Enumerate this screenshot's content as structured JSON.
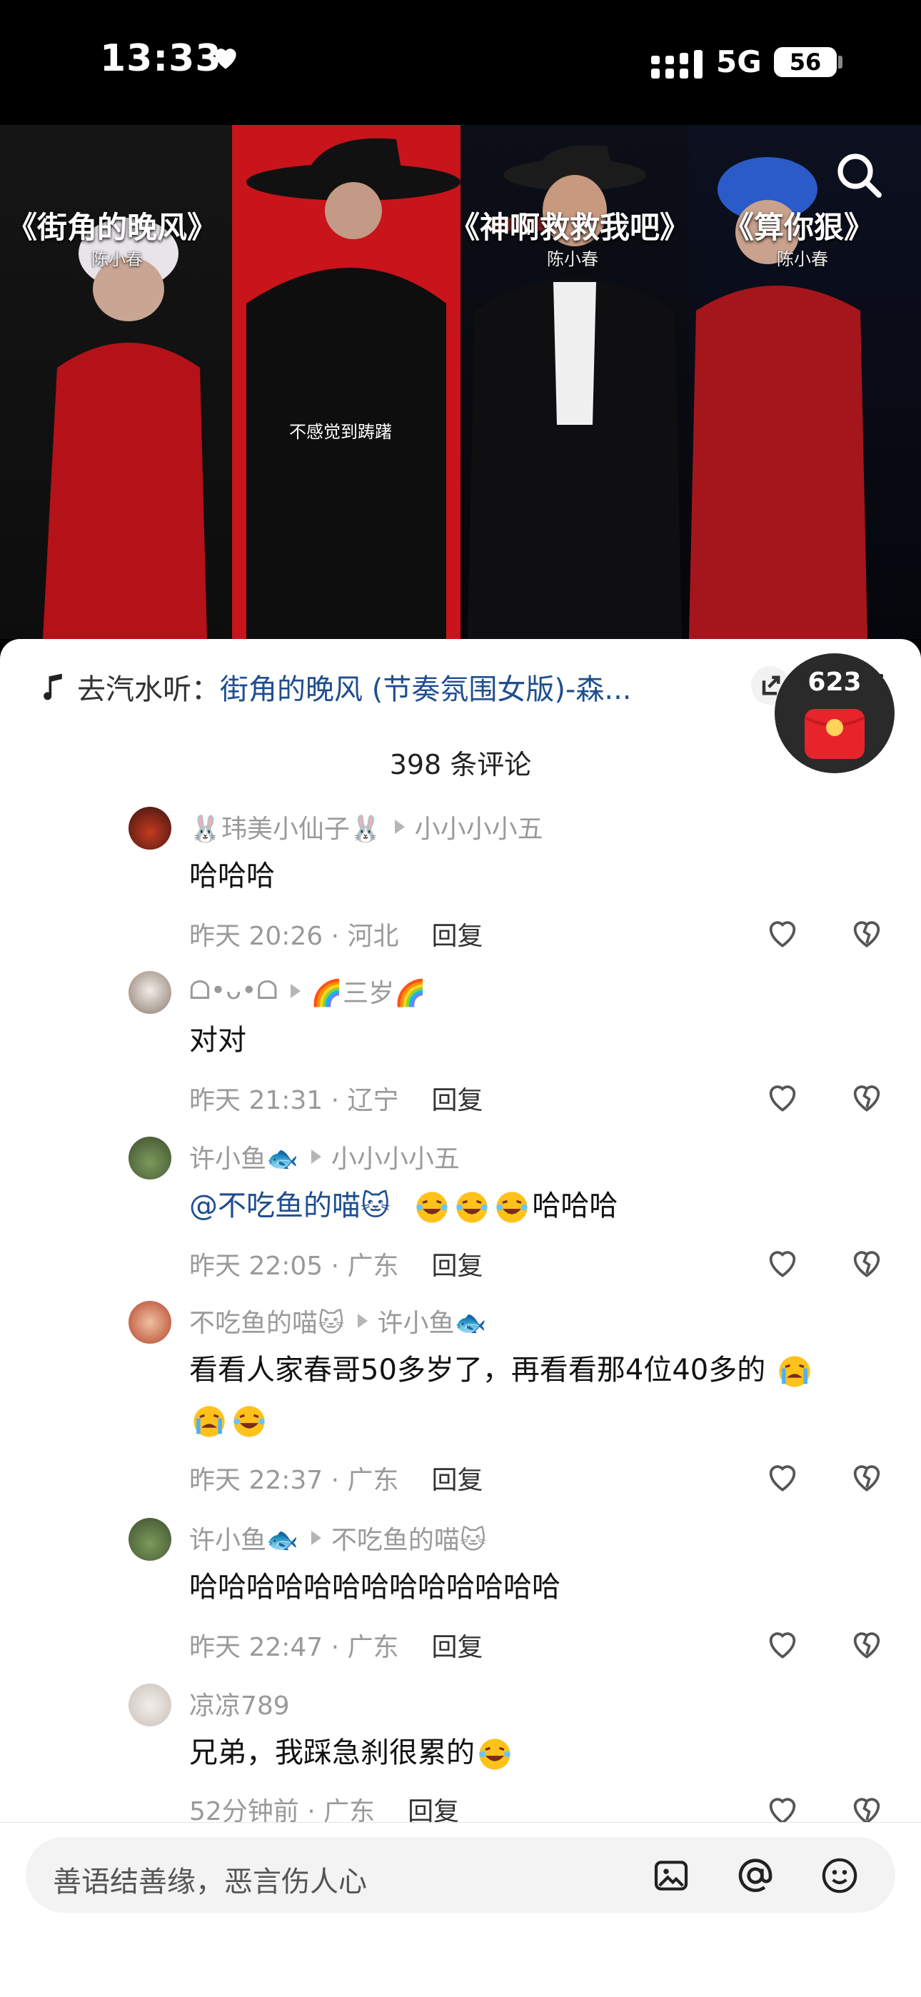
{
  "status_bar": {
    "time": "13:33",
    "network": "5G",
    "battery": "56"
  },
  "video": {
    "songs": [
      {
        "title": "《街角的晚风》",
        "artist": "陈小春"
      },
      {
        "title": "《神啊救救我吧》",
        "artist": "陈小春"
      },
      {
        "title": "《算你狠》",
        "artist": "陈小春"
      }
    ],
    "subtitle": "不感觉到踌躇"
  },
  "music_bar": {
    "prefix": "去汽水听：",
    "title": "街角的晚风 (节奏氛围女版)-森..."
  },
  "red_packet": {
    "count": "623"
  },
  "comments_header": {
    "count_label": "398 条评论"
  },
  "comments": [
    {
      "user": "🐰玮美小仙子🐰",
      "reply_to": "小小小小五",
      "text": "哈哈哈",
      "time": "昨天 20:26 · 河北",
      "reply": "回复"
    },
    {
      "user": "ᗝ•ᴗ•ᗝ",
      "reply_to": "🌈三岁🌈",
      "text": "对对",
      "time": "昨天 21:31 · 辽宁",
      "reply": "回复"
    },
    {
      "user": "许小鱼🐟",
      "reply_to": "小小小小五",
      "mention": "@不吃鱼的喵🐱",
      "text": "哈哈哈",
      "time": "昨天 22:05 · 广东",
      "reply": "回复"
    },
    {
      "user": "不吃鱼的喵🐱",
      "reply_to": "许小鱼🐟",
      "text": "看看人家春哥50多岁了，再看看那4位40多的",
      "time": "昨天 22:37 · 广东",
      "reply": "回复"
    },
    {
      "user": "许小鱼🐟",
      "reply_to": "不吃鱼的喵🐱",
      "text": "哈哈哈哈哈哈哈哈哈哈哈哈哈",
      "time": "昨天 22:47 · 广东",
      "reply": "回复"
    },
    {
      "user": "凉凉789",
      "text": "兄弟，我踩急刹很累的",
      "time": "52分钟前 · 广东",
      "reply": "回复"
    }
  ],
  "input_bar": {
    "placeholder": "善语结善缘，恶言伤人心"
  },
  "icons": [
    "heart-icon",
    "signal-icon",
    "search-icon",
    "music-note-icon",
    "share-icon",
    "close-icon",
    "red-packet-icon",
    "like-icon",
    "dislike-icon",
    "image-icon",
    "at-icon",
    "emoji-icon"
  ],
  "colors": {
    "accent_link": "#1f4e8f",
    "video_red": "#c8141a",
    "meta_gray": "#9a9a9a"
  }
}
